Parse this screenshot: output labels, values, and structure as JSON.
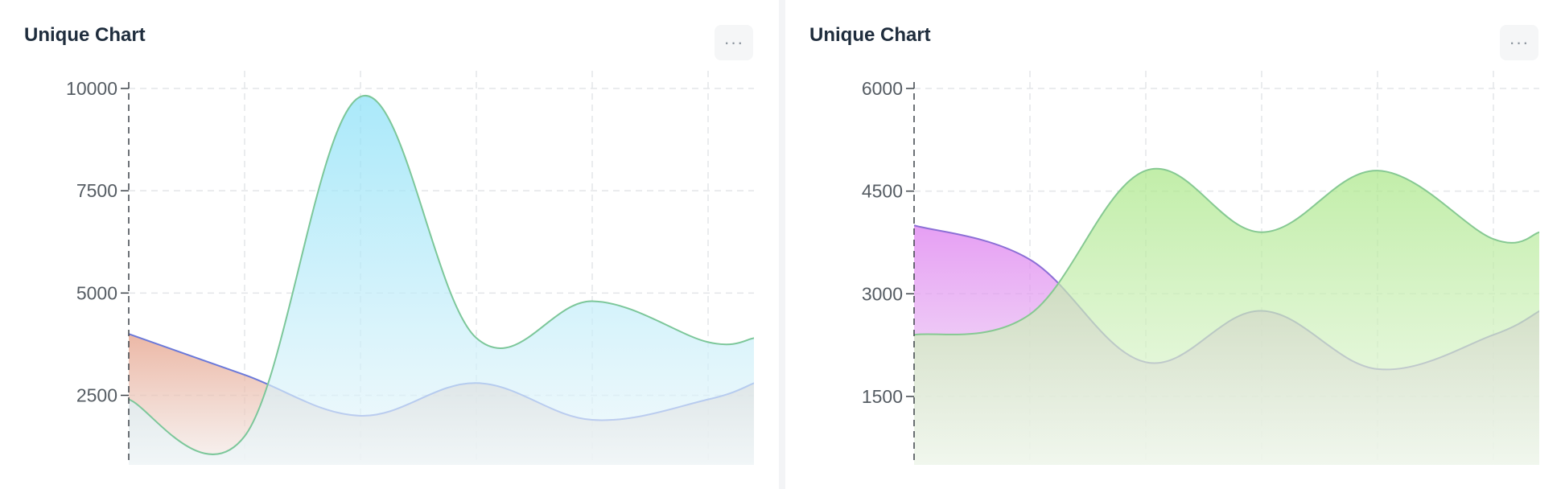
{
  "cards": [
    {
      "title": "Unique Chart",
      "menu_label": "···",
      "chart_data": {
        "type": "area",
        "title": "Unique Chart",
        "x": [
          0,
          1,
          2,
          3,
          4,
          5,
          5.4
        ],
        "ylim": [
          800,
          10000
        ],
        "yticks": [
          2500,
          5000,
          7500,
          10000
        ],
        "tick_labels": [
          "2500",
          "5000",
          "7500",
          "10000"
        ],
        "grid": true,
        "series": [
          {
            "values": [
              4000,
              3000,
              2000,
              2800,
              1900,
              2400,
              2800
            ],
            "color": "#6b79d9",
            "fill_top": "#e49b82",
            "fill_bottom": "#f3eeec"
          },
          {
            "values": [
              2400,
              1500,
              9800,
              3900,
              4800,
              3800,
              3900
            ],
            "color": "#7cc79a",
            "fill_top": "#88e0f8",
            "fill_bottom": "#eef7fa"
          }
        ]
      }
    },
    {
      "title": "Unique Chart",
      "menu_label": "···",
      "chart_data": {
        "type": "area",
        "title": "Unique Chart",
        "x": [
          0,
          1,
          2,
          3,
          4,
          5,
          5.4
        ],
        "ylim": [
          500,
          6000
        ],
        "yticks": [
          1500,
          3000,
          4500,
          6000
        ],
        "tick_labels": [
          "1500",
          "3000",
          "4500",
          "6000"
        ],
        "grid": true,
        "series": [
          {
            "values": [
              4000,
              3500,
              2000,
              2750,
              1900,
              2400,
              2750
            ],
            "color": "#8c6fd6",
            "fill_top": "#dc78ef",
            "fill_bottom": "#f2f0f5"
          },
          {
            "values": [
              2400,
              2700,
              4800,
              3900,
              4800,
              3800,
              3900
            ],
            "color": "#86c992",
            "fill_top": "#a9e786",
            "fill_bottom": "#eef8e8"
          }
        ]
      }
    }
  ]
}
